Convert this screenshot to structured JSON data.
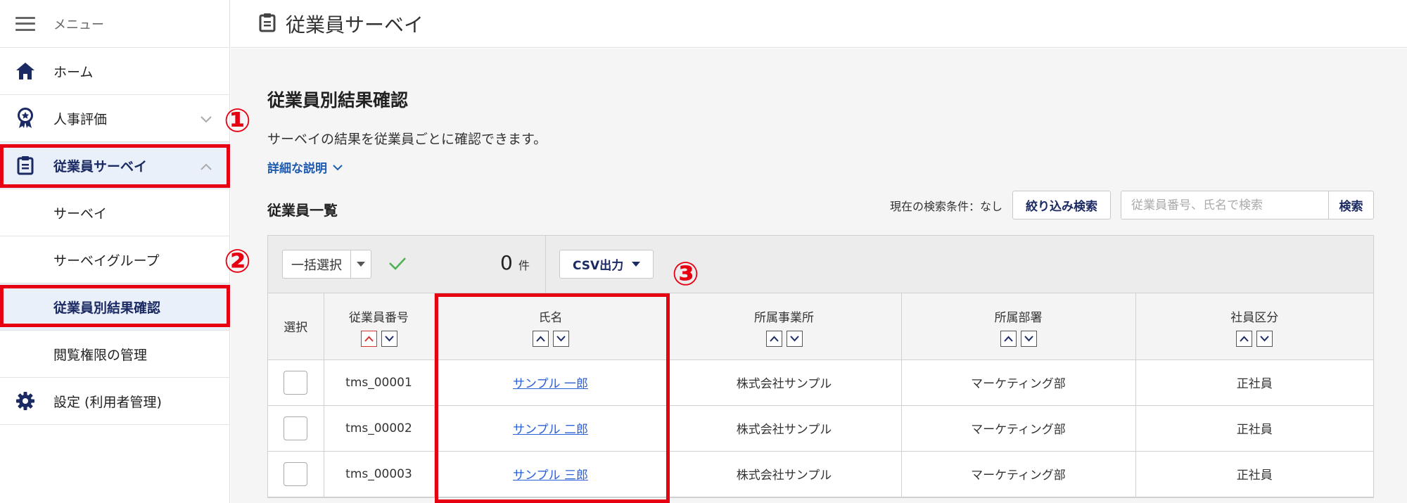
{
  "sidebar": {
    "menu_label": "メニュー",
    "items": [
      {
        "label": "ホーム",
        "icon": "home-icon"
      },
      {
        "label": "人事評価",
        "icon": "award-icon"
      },
      {
        "label": "従業員サーベイ",
        "icon": "clipboard-icon"
      },
      {
        "label": "サーベイ"
      },
      {
        "label": "サーベイグループ"
      },
      {
        "label": "従業員別結果確認"
      },
      {
        "label": "閲覧権限の管理"
      },
      {
        "label": "設定 (利用者管理)",
        "icon": "gear-icon"
      }
    ]
  },
  "header": {
    "title": "従業員サーベイ",
    "icon": "clipboard-icon"
  },
  "main": {
    "heading": "従業員別結果確認",
    "description": "サーベイの結果を従業員ごとに確認できます。",
    "detail_link": "詳細な説明",
    "list_title": "従業員一覧",
    "search_condition": "現在の検索条件：なし",
    "filter_button": "絞り込み検索",
    "search_placeholder": "従業員番号、氏名で検索",
    "search_button": "検索",
    "toolbar": {
      "bulk_select": "一括選択",
      "count": "0",
      "count_unit": "件",
      "csv_button": "CSV出力"
    },
    "columns": [
      "選択",
      "従業員番号",
      "氏名",
      "所属事業所",
      "所属部署",
      "社員区分"
    ],
    "rows": [
      {
        "id": "tms_00001",
        "name": "サンプル 一郎",
        "office": "株式会社サンプル",
        "dept": "マーケティング部",
        "type": "正社員"
      },
      {
        "id": "tms_00002",
        "name": "サンプル 二郎",
        "office": "株式会社サンプル",
        "dept": "マーケティング部",
        "type": "正社員"
      },
      {
        "id": "tms_00003",
        "name": "サンプル 三郎",
        "office": "株式会社サンプル",
        "dept": "マーケティング部",
        "type": "正社員"
      }
    ]
  },
  "annotations": {
    "one": "①",
    "two": "②",
    "three": "③"
  },
  "colors": {
    "accent": "#1b2a63",
    "highlight": "#e60012",
    "link": "#2a5fd6",
    "active_bg": "#eaf0fa"
  }
}
